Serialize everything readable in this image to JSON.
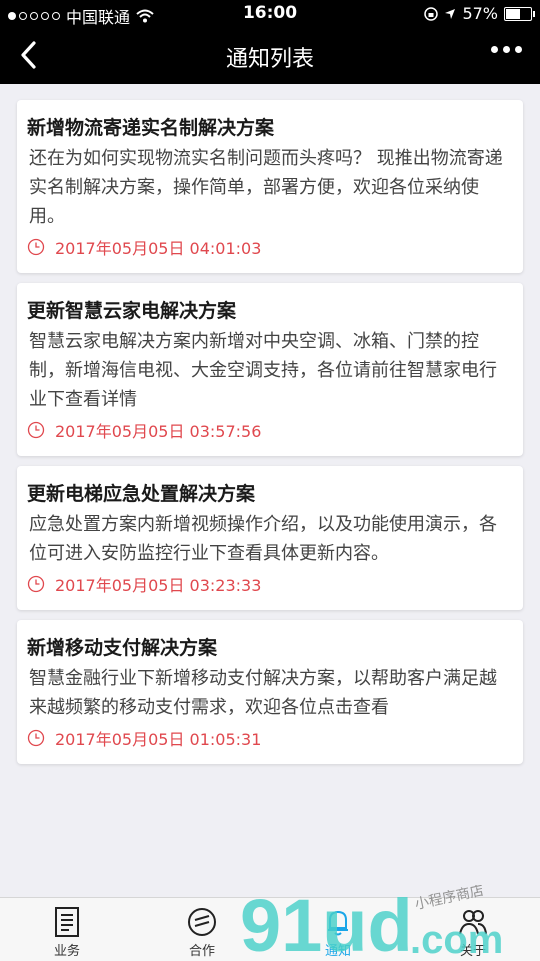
{
  "status_bar": {
    "carrier": "中国联通",
    "time": "16:00",
    "battery": "57%",
    "battery_level": 0.57
  },
  "header": {
    "title": "通知列表"
  },
  "notifications": [
    {
      "title": "新增物流寄递实名制解决方案",
      "body": "还在为如何实现物流实名制问题而头疼吗？ 现推出物流寄递实名制解决方案，操作简单，部署方便，欢迎各位采纳使用。",
      "time": "2017年05月05日 04:01:03"
    },
    {
      "title": "更新智慧云家电解决方案",
      "body": "智慧云家电解决方案内新增对中央空调、冰箱、门禁的控制，新增海信电视、大金空调支持，各位请前往智慧家电行业下查看详情",
      "time": "2017年05月05日 03:57:56"
    },
    {
      "title": "更新电梯应急处置解决方案",
      "body": "应急处置方案内新增视频操作介绍，以及功能使用演示，各位可进入安防监控行业下查看具体更新内容。",
      "time": "2017年05月05日 03:23:33"
    },
    {
      "title": "新增移动支付解决方案",
      "body": "智慧金融行业下新增移动支付解决方案，以帮助客户满足越来越频繁的移动支付需求，欢迎各位点击查看",
      "time": "2017年05月05日 01:05:31"
    }
  ],
  "tab_bar": {
    "items": [
      {
        "label": "业务",
        "icon": "document-icon"
      },
      {
        "label": "合作",
        "icon": "cooperation-icon"
      },
      {
        "label": "通知",
        "icon": "bell-icon",
        "active": true
      },
      {
        "label": "关于",
        "icon": "people-icon"
      }
    ]
  },
  "colors": {
    "time_red": "#e0484e",
    "active_tab": "#1aa6e8",
    "header_bg": "#000000",
    "page_bg": "#efeff4"
  },
  "watermark": {
    "brand": "91ud",
    "suffix": ".com",
    "tagline": "小程序商店"
  }
}
